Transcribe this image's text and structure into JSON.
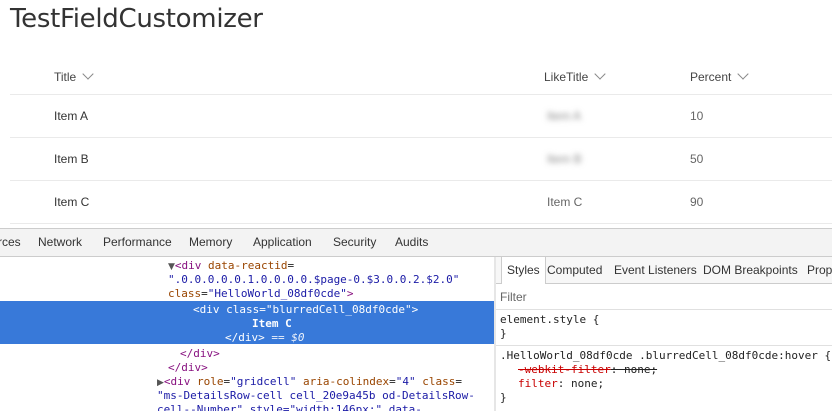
{
  "page": {
    "title": "TestFieldCustomizer"
  },
  "list": {
    "columns": [
      {
        "label": "Title"
      },
      {
        "label": "LikeTitle"
      },
      {
        "label": "Percent"
      }
    ],
    "rows": [
      {
        "title": "Item A",
        "like": "Item A",
        "like_blurred": true,
        "percent": "10"
      },
      {
        "title": "Item B",
        "like": "Item B",
        "like_blurred": true,
        "percent": "50"
      },
      {
        "title": "Item C",
        "like": "Item C",
        "like_blurred": false,
        "percent": "90"
      }
    ]
  },
  "devtools": {
    "tabs": [
      "rces",
      "Network",
      "Performance",
      "Memory",
      "Application",
      "Security",
      "Audits"
    ],
    "dom": {
      "l1_tag_open": "<div",
      "l1_attr": "data-reactid",
      "l1_eq": "=",
      "l2_val": "\".0.0.0.0.0.1.0.0.0.0.$page-0.$3.0.0.2.$2.0\"",
      "l3_attr": "class",
      "l3_eq": "=",
      "l3_val": "\"HelloWorld_08df0cde\"",
      "l3_close": ">",
      "sel_tag_open": "<div",
      "sel_attr": "class",
      "sel_eq": "=",
      "sel_val": "\"blurredCell_08df0cde\"",
      "sel_close": ">",
      "sel_text": "Item C",
      "sel_end_tag": "</div>",
      "sel_marker": "== $0",
      "close1": "</div>",
      "close2": "</div>",
      "g_tag_open": "<div",
      "g_attr1": "role",
      "g_eq1": "=",
      "g_val1": "\"gridcell\"",
      "g_attr2": "aria-colindex",
      "g_eq2": "=",
      "g_val2": "\"4\"",
      "g_attr3": "class",
      "g_eq3": "=",
      "g_val3a": "\"",
      "g_val3b": "ms-DetailsRow-cell cell_20e9a45b od-DetailsRow-",
      "g_val3c": "cell--Number\" style=\"width:146px;\" data-"
    },
    "styles_tabs": [
      "Styles",
      "Computed",
      "Event Listeners",
      "DOM Breakpoints",
      "Prop"
    ],
    "filter_placeholder": "Filter",
    "element_style": {
      "selector": "element.style {",
      "close": "}"
    },
    "rule": {
      "selector": ".HelloWorld_08df0cde .blurredCell_08df0cde:hover {",
      "decl1_prop": "-webkit-filter",
      "decl1_val": ": none;",
      "decl2_prop": "filter",
      "decl2_val": ": none;",
      "close": "}"
    }
  }
}
